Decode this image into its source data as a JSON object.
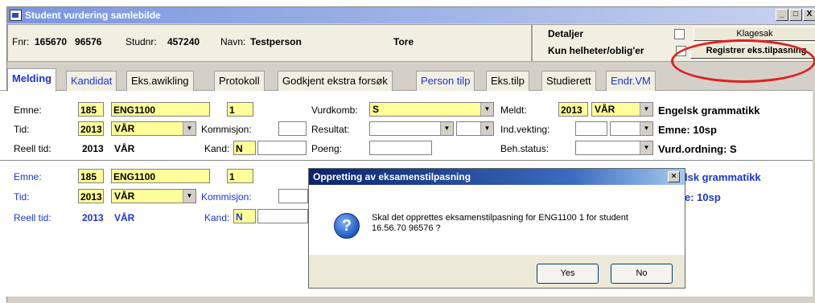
{
  "window": {
    "title": "Student vurdering samlebilde",
    "controls": [
      "_",
      "□",
      "X"
    ]
  },
  "header": {
    "fnr_label": "Fnr:",
    "fnr_value": "165670   96576",
    "studnr_label": "Studnr:",
    "studnr_value": "457240",
    "navn_label": "Navn:",
    "navn_value": "Testperson",
    "fornavn": "Tore"
  },
  "details": {
    "detaljer_label": "Detaljer",
    "kun_label": "Kun helheter/oblig'er",
    "klagesak_button": "Klagesak",
    "registrer_button": "Registrer eks.tilpasning"
  },
  "tabs": [
    {
      "label": "Melding"
    },
    {
      "label": "Kandidat"
    },
    {
      "label": "Eks.awikling"
    },
    {
      "label": "Protokoll"
    },
    {
      "label": "Godkjent ekstra forsøk"
    },
    {
      "label": "Person tilp"
    },
    {
      "label": "Eks.tilp"
    },
    {
      "label": "Studierett"
    },
    {
      "label": "Endr.VM"
    }
  ],
  "record1": {
    "emne_label": "Emne:",
    "emne_nr": "185",
    "emne_kode": "ENG1100",
    "emne_versjon": "1",
    "tid_label": "Tid:",
    "tid_ar": "2013",
    "tid_termin": "VÅR",
    "kommisjon_label": "Kommisjon:",
    "reell_label": "Reell tid:",
    "reell_ar": "2013",
    "reell_termin": "VÅR",
    "kand_label": "Kand:",
    "kand_value": "N",
    "vurdkomb_label": "Vurdkomb:",
    "vurdkomb_value": "S",
    "resultat_label": "Resultat:",
    "poeng_label": "Poeng:",
    "meldt_label": "Meldt:",
    "meldt_ar": "2013",
    "meldt_termin": "VÅR",
    "indvekting_label": "Ind.vekting:",
    "behstatus_label": "Beh.status:",
    "emnenavn": "Engelsk grammatikk",
    "emne_sp": "Emne: 10sp",
    "vurdordning": "Vurd.ordning: S"
  },
  "record2": {
    "emne_label": "Emne:",
    "emne_nr": "185",
    "emne_kode": "ENG1100",
    "emne_versjon": "1",
    "tid_label": "Tid:",
    "tid_ar": "2013",
    "tid_termin": "VÅR",
    "kommisjon_label": "Kommisjon:",
    "reell_label": "Reell tid:",
    "reell_ar": "2013",
    "reell_termin": "VÅR",
    "kand_label": "Kand:",
    "kand_value": "N",
    "emnenavn_partial": "lsk grammatikk",
    "emne_sp_partial": "e: 10sp"
  },
  "dialog": {
    "title": "Oppretting av eksamenstilpasning",
    "message_line1": "Skal det opprettes eksamenstilpasning for ENG1100 1 for student",
    "message_line2": "16.56.70 96576 ?",
    "yes": "Yes",
    "no": "No",
    "close": "×"
  },
  "colors": {
    "highlight_oval": "#e02020",
    "field_yellow": "#ffff99",
    "link_blue": "#1a35d6"
  }
}
